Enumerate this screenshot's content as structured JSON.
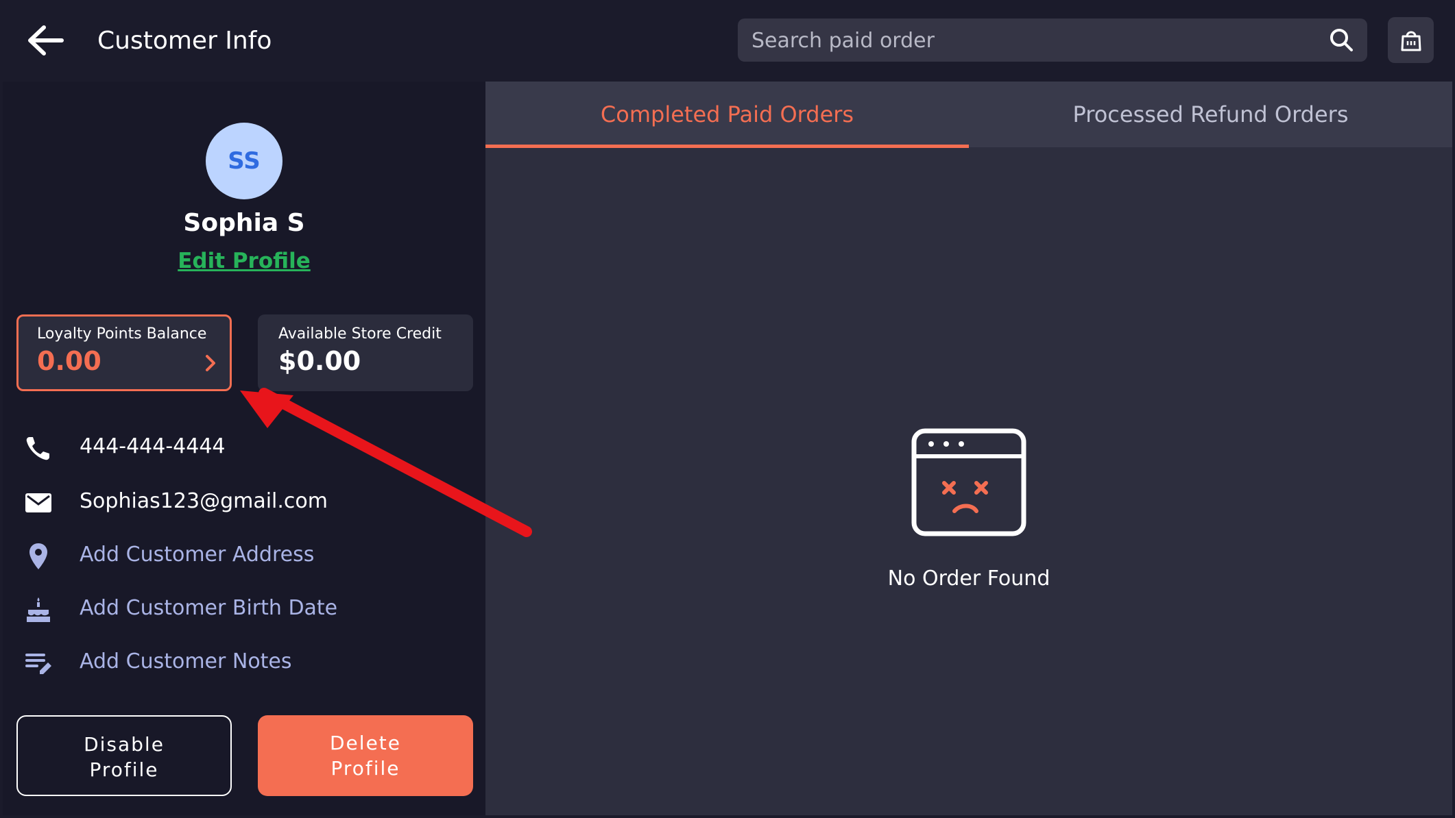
{
  "header": {
    "title": "Customer Info",
    "search_placeholder": "Search paid order"
  },
  "customer": {
    "initials": "SS",
    "name": "Sophia S",
    "edit_label": "Edit Profile",
    "avatar_color": "#bcd4ff"
  },
  "cards": {
    "loyalty_label": "Loyalty Points Balance",
    "loyalty_value": "0.00",
    "credit_label": "Available Store Credit",
    "credit_value": "$0.00"
  },
  "info": {
    "phone": "444-444-4444",
    "email": "Sophias123@gmail.com",
    "address_action": "Add Customer Address",
    "birthdate_action": "Add Customer Birth Date",
    "notes_action": "Add Customer Notes"
  },
  "buttons": {
    "disable_line1": "Disable",
    "disable_line2": "Profile",
    "delete_line1": "Delete",
    "delete_line2": "Profile"
  },
  "tabs": [
    {
      "label": "Completed Paid Orders",
      "active": true
    },
    {
      "label": "Processed Refund Orders",
      "active": false
    }
  ],
  "empty_state": {
    "message": "No Order Found"
  },
  "colors": {
    "accent": "#f46e52",
    "link_green": "#27b35a",
    "action_text": "#aab4e6",
    "annotation_arrow": "#e8151b"
  },
  "icons": [
    "back-arrow-icon",
    "search-icon",
    "scan-bag-icon",
    "phone-icon",
    "email-icon",
    "location-pin-icon",
    "cake-icon",
    "notes-edit-icon",
    "chevron-right-icon",
    "empty-order-icon"
  ]
}
